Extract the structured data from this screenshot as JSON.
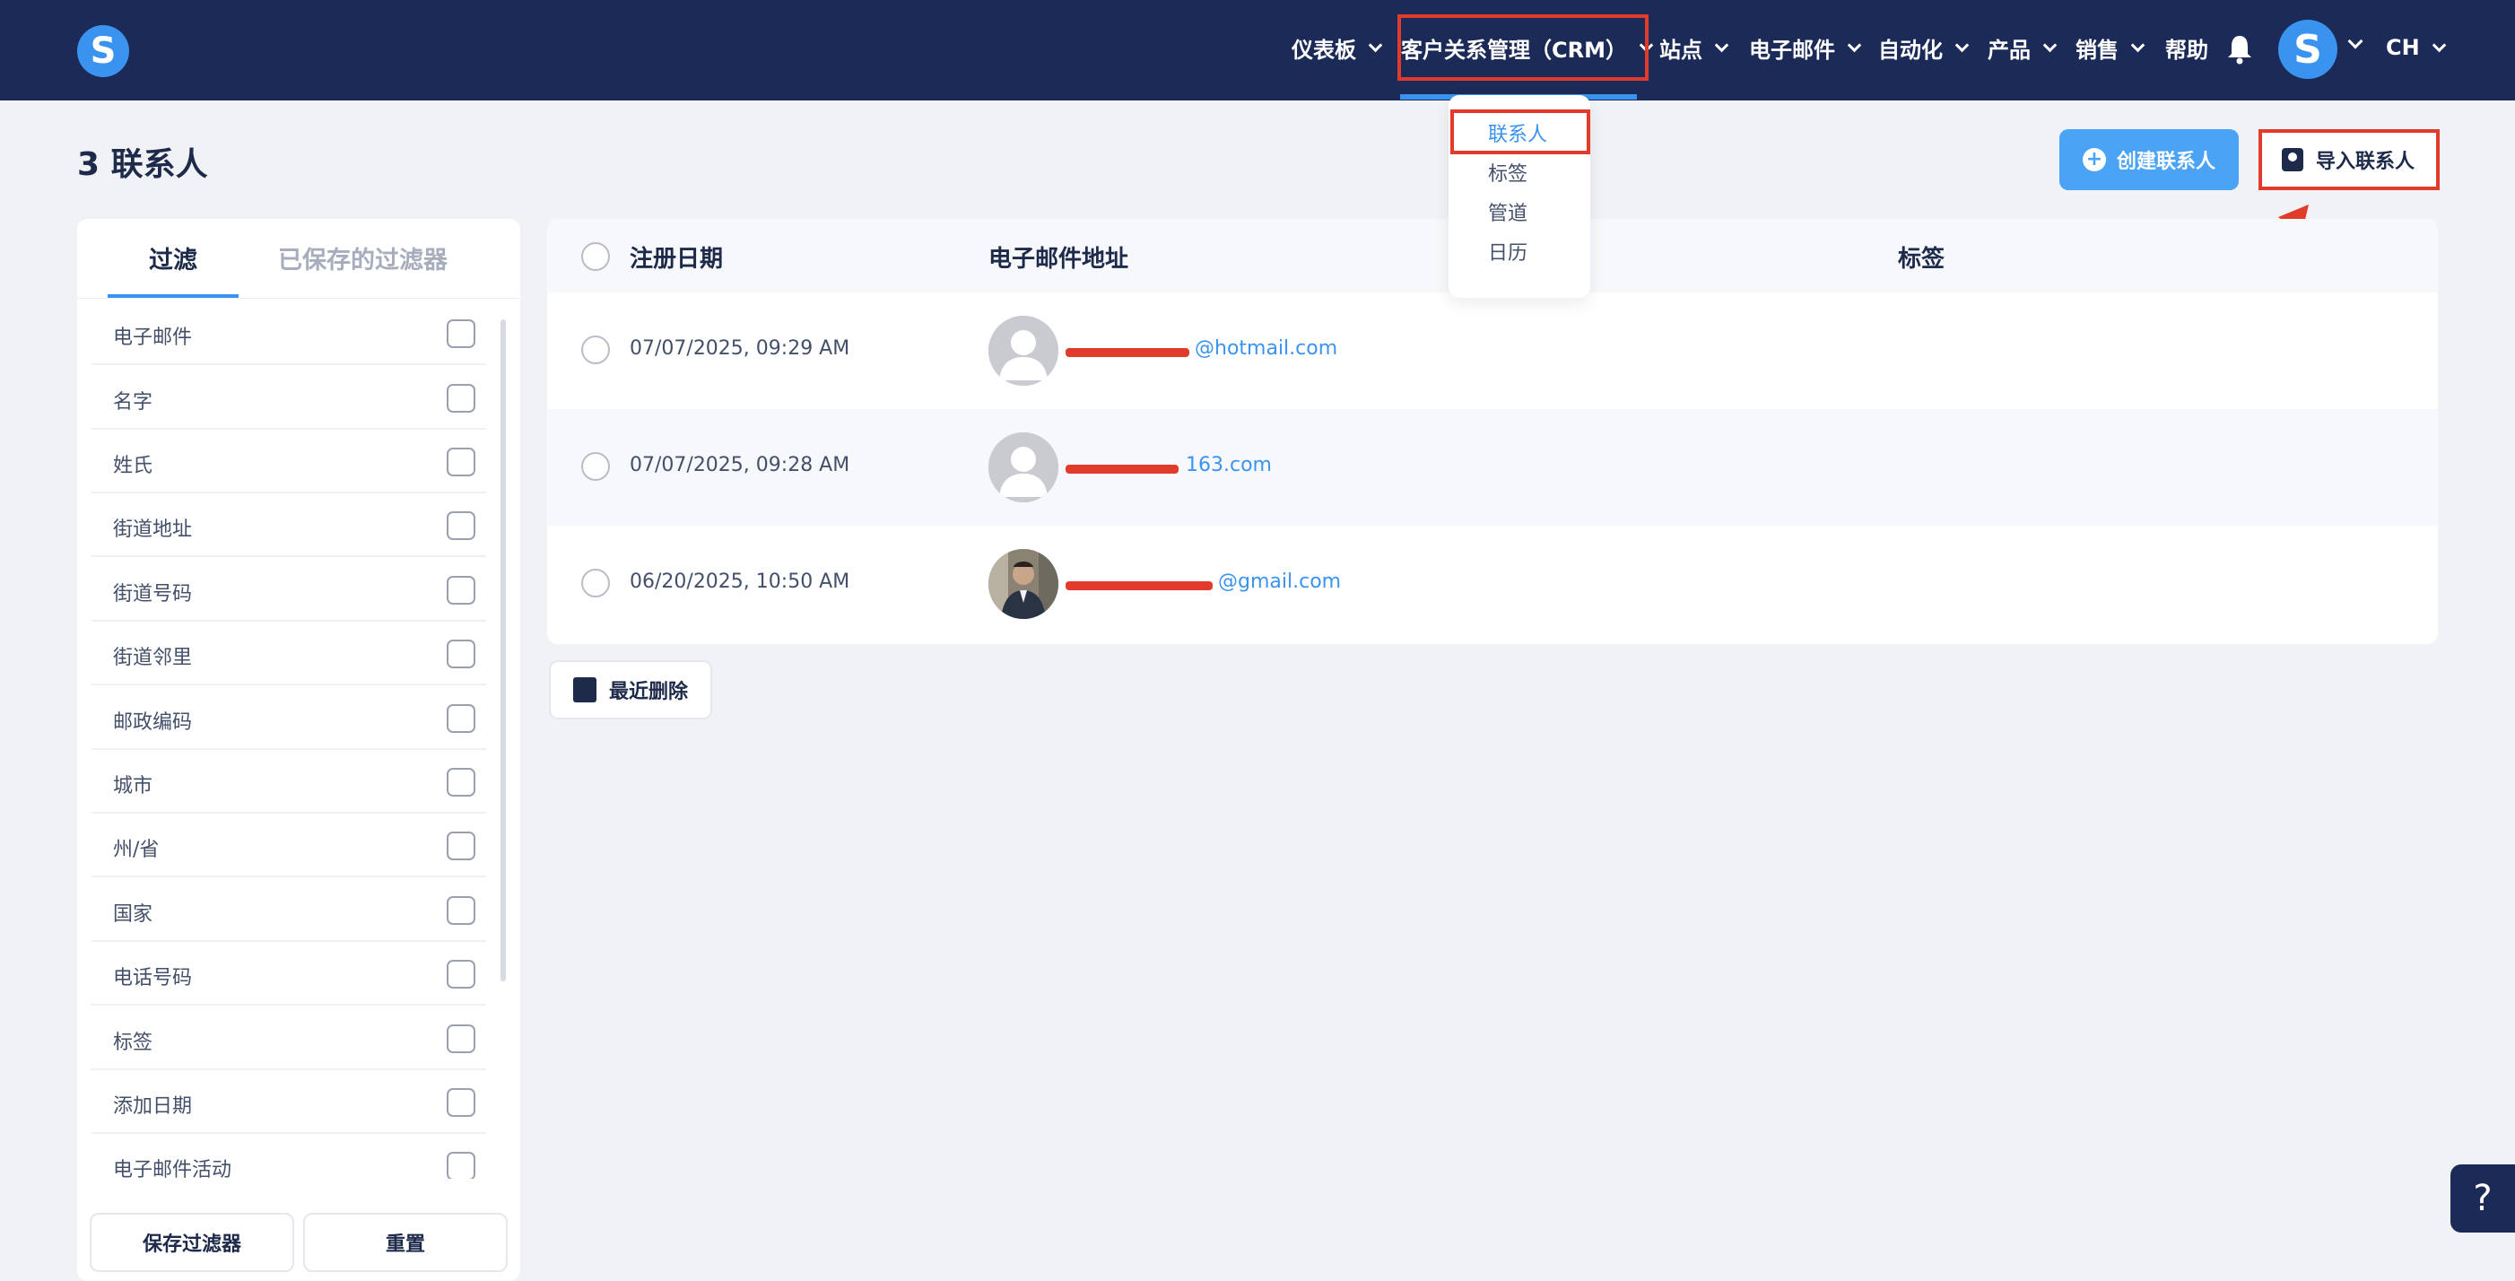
{
  "app": {
    "logo_letter": "S"
  },
  "nav": {
    "items": [
      {
        "label": "仪表板"
      },
      {
        "label": "客户关系管理（CRM）"
      },
      {
        "label": "站点"
      },
      {
        "label": "电子邮件"
      },
      {
        "label": "自动化"
      },
      {
        "label": "产品"
      },
      {
        "label": "销售"
      },
      {
        "label": "帮助"
      }
    ],
    "active_index": 1,
    "avatar_letter": "S",
    "language": "CH"
  },
  "crm_dropdown": {
    "items": [
      {
        "label": "联系人",
        "active": true
      },
      {
        "label": "标签"
      },
      {
        "label": "管道"
      },
      {
        "label": "日历"
      }
    ]
  },
  "page": {
    "title": "3 联系人",
    "create_button": "创建联系人",
    "import_button": "导入联系人"
  },
  "filters": {
    "tab_filter": "过滤",
    "tab_saved": "已保存的过滤器",
    "items": [
      {
        "label": "电子邮件"
      },
      {
        "label": "名字"
      },
      {
        "label": "姓氏"
      },
      {
        "label": "街道地址"
      },
      {
        "label": "街道号码"
      },
      {
        "label": "街道邻里"
      },
      {
        "label": "邮政编码"
      },
      {
        "label": "城市"
      },
      {
        "label": "州/省"
      },
      {
        "label": "国家"
      },
      {
        "label": "电话号码"
      },
      {
        "label": "标签"
      },
      {
        "label": "添加日期"
      },
      {
        "label": "电子邮件活动"
      }
    ],
    "save_button": "保存过滤器",
    "reset_button": "重置"
  },
  "table": {
    "columns": {
      "date": "注册日期",
      "email": "电子邮件地址",
      "tags": "标签"
    },
    "rows": [
      {
        "date": "07/07/2025, 09:29 AM",
        "email_visible": "@hotmail.com",
        "avatar": "default"
      },
      {
        "date": "07/07/2025, 09:28 AM",
        "email_visible": "163.com",
        "avatar": "default"
      },
      {
        "date": "06/20/2025, 10:50 AM",
        "email_visible": "@gmail.com",
        "avatar": "photo"
      }
    ]
  },
  "recent_delete_button": "最近删除",
  "help_button": "?",
  "colors": {
    "nav_bg": "#1b2a57",
    "accent": "#3b93f0",
    "annotation_red": "#e13b2b",
    "page_bg": "#f1f2f6"
  },
  "icons": [
    "bell-icon",
    "plus-circle-icon",
    "contact-card-icon",
    "trash-clock-icon",
    "chevron-down-icon",
    "help-icon",
    "user-avatar-icon"
  ]
}
